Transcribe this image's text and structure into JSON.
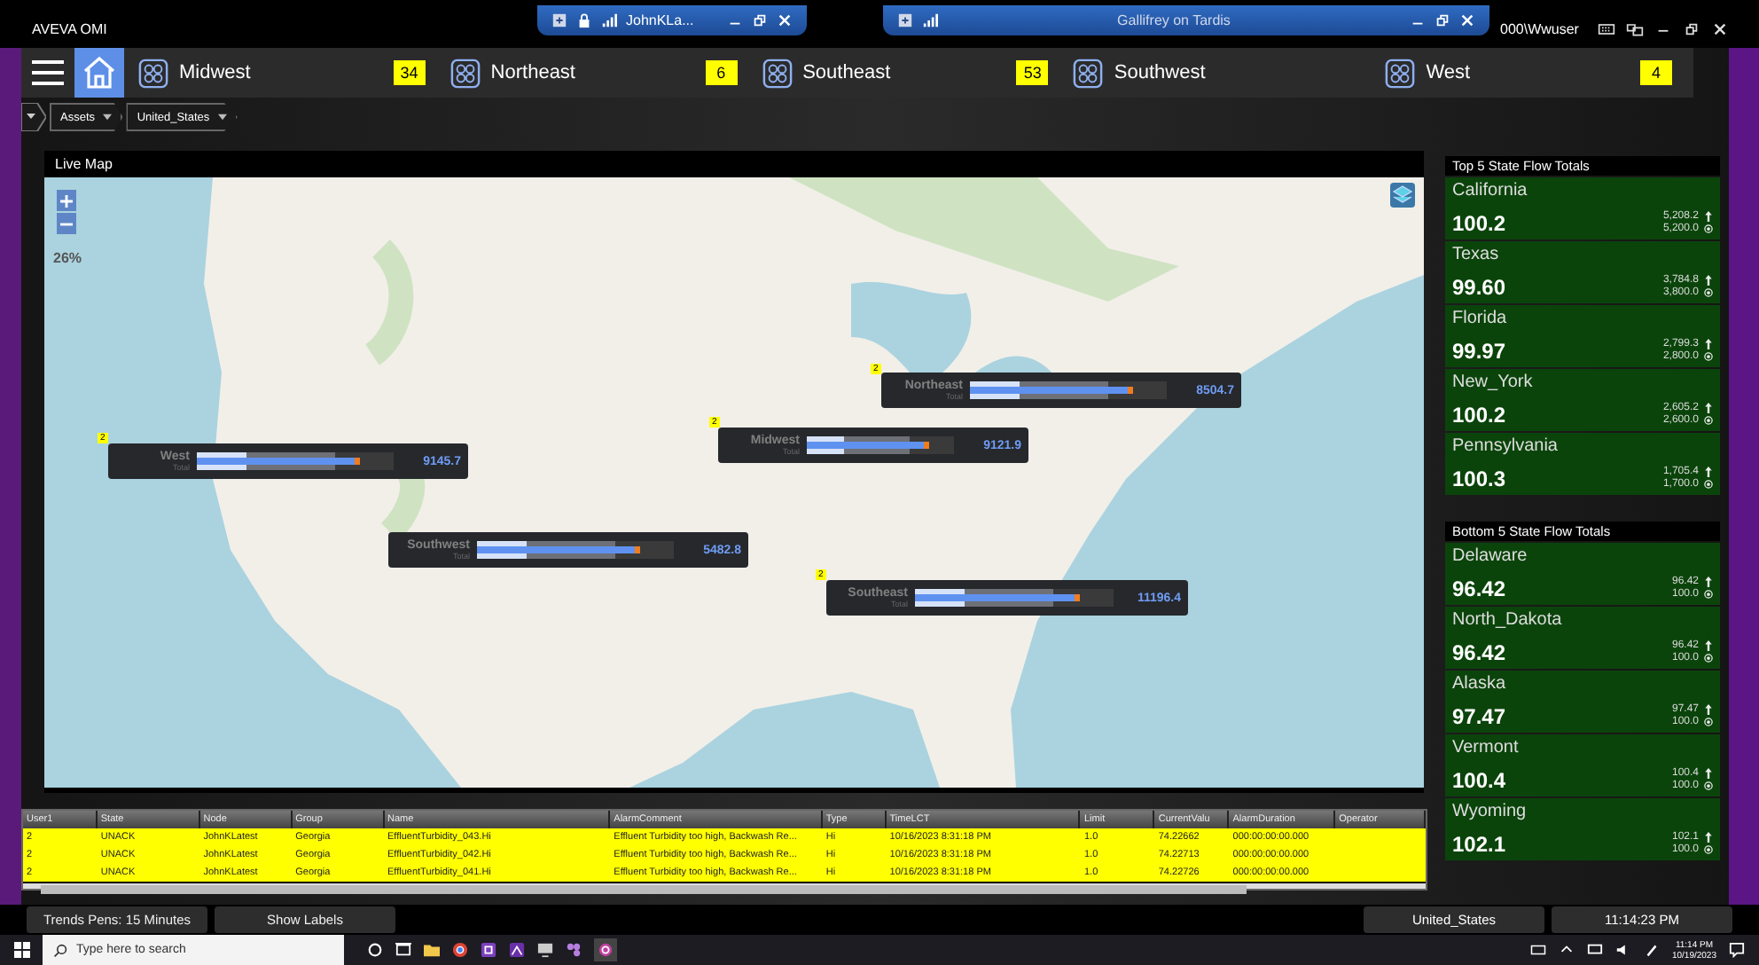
{
  "app_title": "AVEVA OMI",
  "remote_bars": [
    {
      "title": "JohnKLa...",
      "kind": "short"
    },
    {
      "title": "Gallifrey on Tardis",
      "kind": "wide"
    }
  ],
  "user": "000\\Wwuser",
  "regions": [
    {
      "name": "Midwest",
      "count": "34"
    },
    {
      "name": "Northeast",
      "count": "6"
    },
    {
      "name": "Southeast",
      "count": "53"
    },
    {
      "name": "Southwest"
    },
    {
      "name": "West",
      "count": "4"
    }
  ],
  "breadcrumb": [
    "Assets",
    "United_States"
  ],
  "map": {
    "title": "Live Map",
    "zoom": "26%",
    "markers": [
      {
        "name": "West",
        "sub": "Total",
        "value": "9145.7",
        "level": 0.83,
        "badge": "2"
      },
      {
        "name": "Midwest",
        "sub": "Total",
        "value": "9121.9",
        "level": 0.83,
        "badge": "2"
      },
      {
        "name": "Northeast",
        "sub": "Total",
        "value": "8504.7",
        "level": 0.83,
        "badge": "2"
      },
      {
        "name": "Southwest",
        "sub": "Total",
        "value": "5482.8",
        "level": 0.83
      },
      {
        "name": "Southeast",
        "sub": "Total",
        "value": "11196.4",
        "level": 0.83,
        "badge": "2"
      }
    ]
  },
  "panels": [
    {
      "title": "Top 5 State Flow Totals",
      "items": [
        {
          "name": "California",
          "value": "100.2",
          "actual": "5,208.2",
          "target": "5,200.0"
        },
        {
          "name": "Texas",
          "value": "99.60",
          "actual": "3,784.8",
          "target": "3,800.0"
        },
        {
          "name": "Florida",
          "value": "99.97",
          "actual": "2,799.3",
          "target": "2,800.0"
        },
        {
          "name": "New_York",
          "value": "100.2",
          "actual": "2,605.2",
          "target": "2,600.0"
        },
        {
          "name": "Pennsylvania",
          "value": "100.3",
          "actual": "1,705.4",
          "target": "1,700.0"
        }
      ]
    },
    {
      "title": "Bottom 5 State Flow Totals",
      "items": [
        {
          "name": "Delaware",
          "value": "96.42",
          "actual": "96.42",
          "target": "100.0"
        },
        {
          "name": "North_Dakota",
          "value": "96.42",
          "actual": "96.42",
          "target": "100.0"
        },
        {
          "name": "Alaska",
          "value": "97.47",
          "actual": "97.47",
          "target": "100.0"
        },
        {
          "name": "Vermont",
          "value": "100.4",
          "actual": "100.4",
          "target": "100.0"
        },
        {
          "name": "Wyoming",
          "value": "102.1",
          "actual": "102.1",
          "target": "100.0"
        }
      ]
    }
  ],
  "alarms": {
    "columns": [
      "User1",
      "State",
      "Node",
      "Group",
      "Name",
      "AlarmComment",
      "Type",
      "TimeLCT",
      "Limit",
      "CurrentValu",
      "AlarmDuration",
      "Operator"
    ],
    "rows": [
      [
        "2",
        "UNACK",
        "JohnKLatest",
        "Georgia",
        "EffluentTurbidity_043.Hi",
        "Effluent Turbidity too high, Backwash Re...",
        "Hi",
        "10/16/2023 8:31:18 PM",
        "1.0",
        "74.22662",
        "000:00:00:00.000",
        ""
      ],
      [
        "2",
        "UNACK",
        "JohnKLatest",
        "Georgia",
        "EffluentTurbidity_042.Hi",
        "Effluent Turbidity too high, Backwash Re...",
        "Hi",
        "10/16/2023 8:31:18 PM",
        "1.0",
        "74.22713",
        "000:00:00:00.000",
        ""
      ],
      [
        "2",
        "UNACK",
        "JohnKLatest",
        "Georgia",
        "EffluentTurbidity_041.Hi",
        "Effluent Turbidity too high, Backwash Re...",
        "Hi",
        "10/16/2023 8:31:18 PM",
        "1.0",
        "74.22726",
        "000:00:00:00.000",
        ""
      ]
    ]
  },
  "footer": {
    "buttons": [
      "Trends Pens: 15 Minutes",
      "Show Labels"
    ],
    "location": "United_States",
    "clock": "11:14:23 PM"
  },
  "taskbar": {
    "search": {
      "placeholder": "Type here to search"
    },
    "time": "11:14 PM",
    "date": "10/19/2023"
  }
}
